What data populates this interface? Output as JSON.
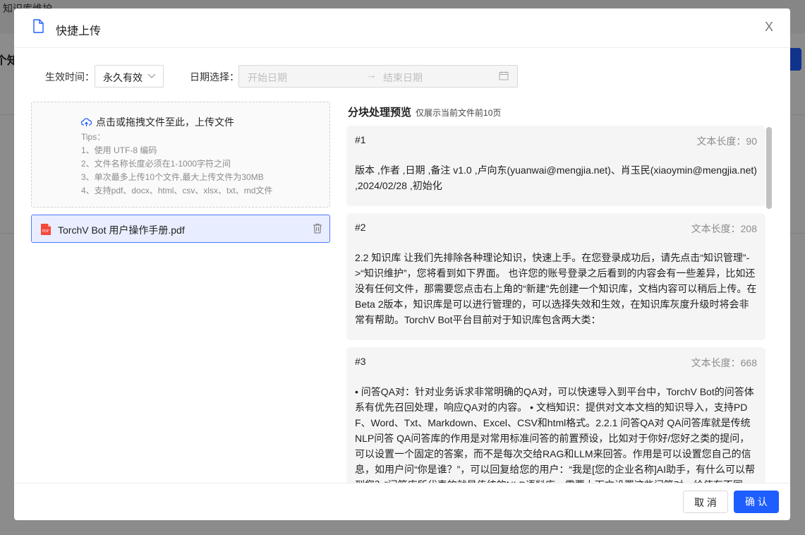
{
  "background": {
    "app_title": "知识库维护",
    "heading": "个知"
  },
  "modal": {
    "title": "快捷上传",
    "close_label": "X"
  },
  "filters": {
    "effective_label": "生效时间：",
    "effective_value": "永久有效",
    "date_label": "日期选择：",
    "start_placeholder": "开始日期",
    "arrow": "→",
    "end_placeholder": "结束日期"
  },
  "upload": {
    "main_text": "点击或拖拽文件至此，上传文件",
    "tips_title": "Tips：",
    "tips": [
      "1、使用 UTF-8 编码",
      "2、文件名称长度必须在1-1000字符之间",
      "3、单次最多上传10个文件,最大上传文件为30MB",
      "4、支持pdf、docx、html、csv、xlsx、txt、md文件"
    ],
    "file_name": "TorchV Bot 用户操作手册.pdf"
  },
  "preview": {
    "title": "分块处理预览",
    "subtitle": "仅展示当前文件前10页",
    "length_label": "文本长度：",
    "chunks": [
      {
        "id": "#1",
        "length": "90",
        "text": "版本 ,作者 ,日期 ,备注  v1.0 ,卢向东(yuanwai@mengjia.net)、肖玉民(xiaoymin@mengjia.net) ,2024/02/28 ,初始化"
      },
      {
        "id": "#2",
        "length": "208",
        "text": "2.2 知识库 让我们先排除各种理论知识，快速上手。在您登录成功后，请先点击“知识管理”->“知识维护”，您将看到如下界面。 也许您的账号登录之后看到的内容会有一些差异，比如还没有任何文件，那需要您点击右上角的“新建”先创建一个知识库，文档内容可以稍后上传。在Beta 2版本，知识库是可以进行管理的，可以选择失效和生效，在知识库灰度升级时将会非常有帮助。TorchV Bot平台目前对于知识库包含两大类："
      },
      {
        "id": "#3",
        "length": "668",
        "text": "• 问答QA对：针对业务诉求非常明确的QA对，可以快速导入到平台中，TorchV Bot的问答体系有优先召回处理，响应QA对的内容。 • 文档知识：提供对文本文档的知识导入，支持PDF、Word、Txt、Markdown、Excel、CSV和html格式。2.2.1  问答QA对 QA问答库就是传统NLP问答 QA问答库的作用是对常用标准问答的前置预设，比如对于你好/您好之类的提问，可以设置一个固定的答案，而不是每次交给RAG和LLM来回答。作用是可以设置您自己的信息，如用户问“你是谁？”，可以回复给您的用户：“我是[您的企业名称]AI助手，有什么可以帮到您？”问答库所代表的就是传统的NLP语料库，需要上下文设置这些问答对，给使有不同"
      }
    ]
  },
  "footer": {
    "cancel_label": "取 消",
    "ok_label": "确 认"
  },
  "colors": {
    "primary": "#1e5eff",
    "file_selected_bg": "#e8eeff",
    "pdf_red": "#f5483b"
  }
}
